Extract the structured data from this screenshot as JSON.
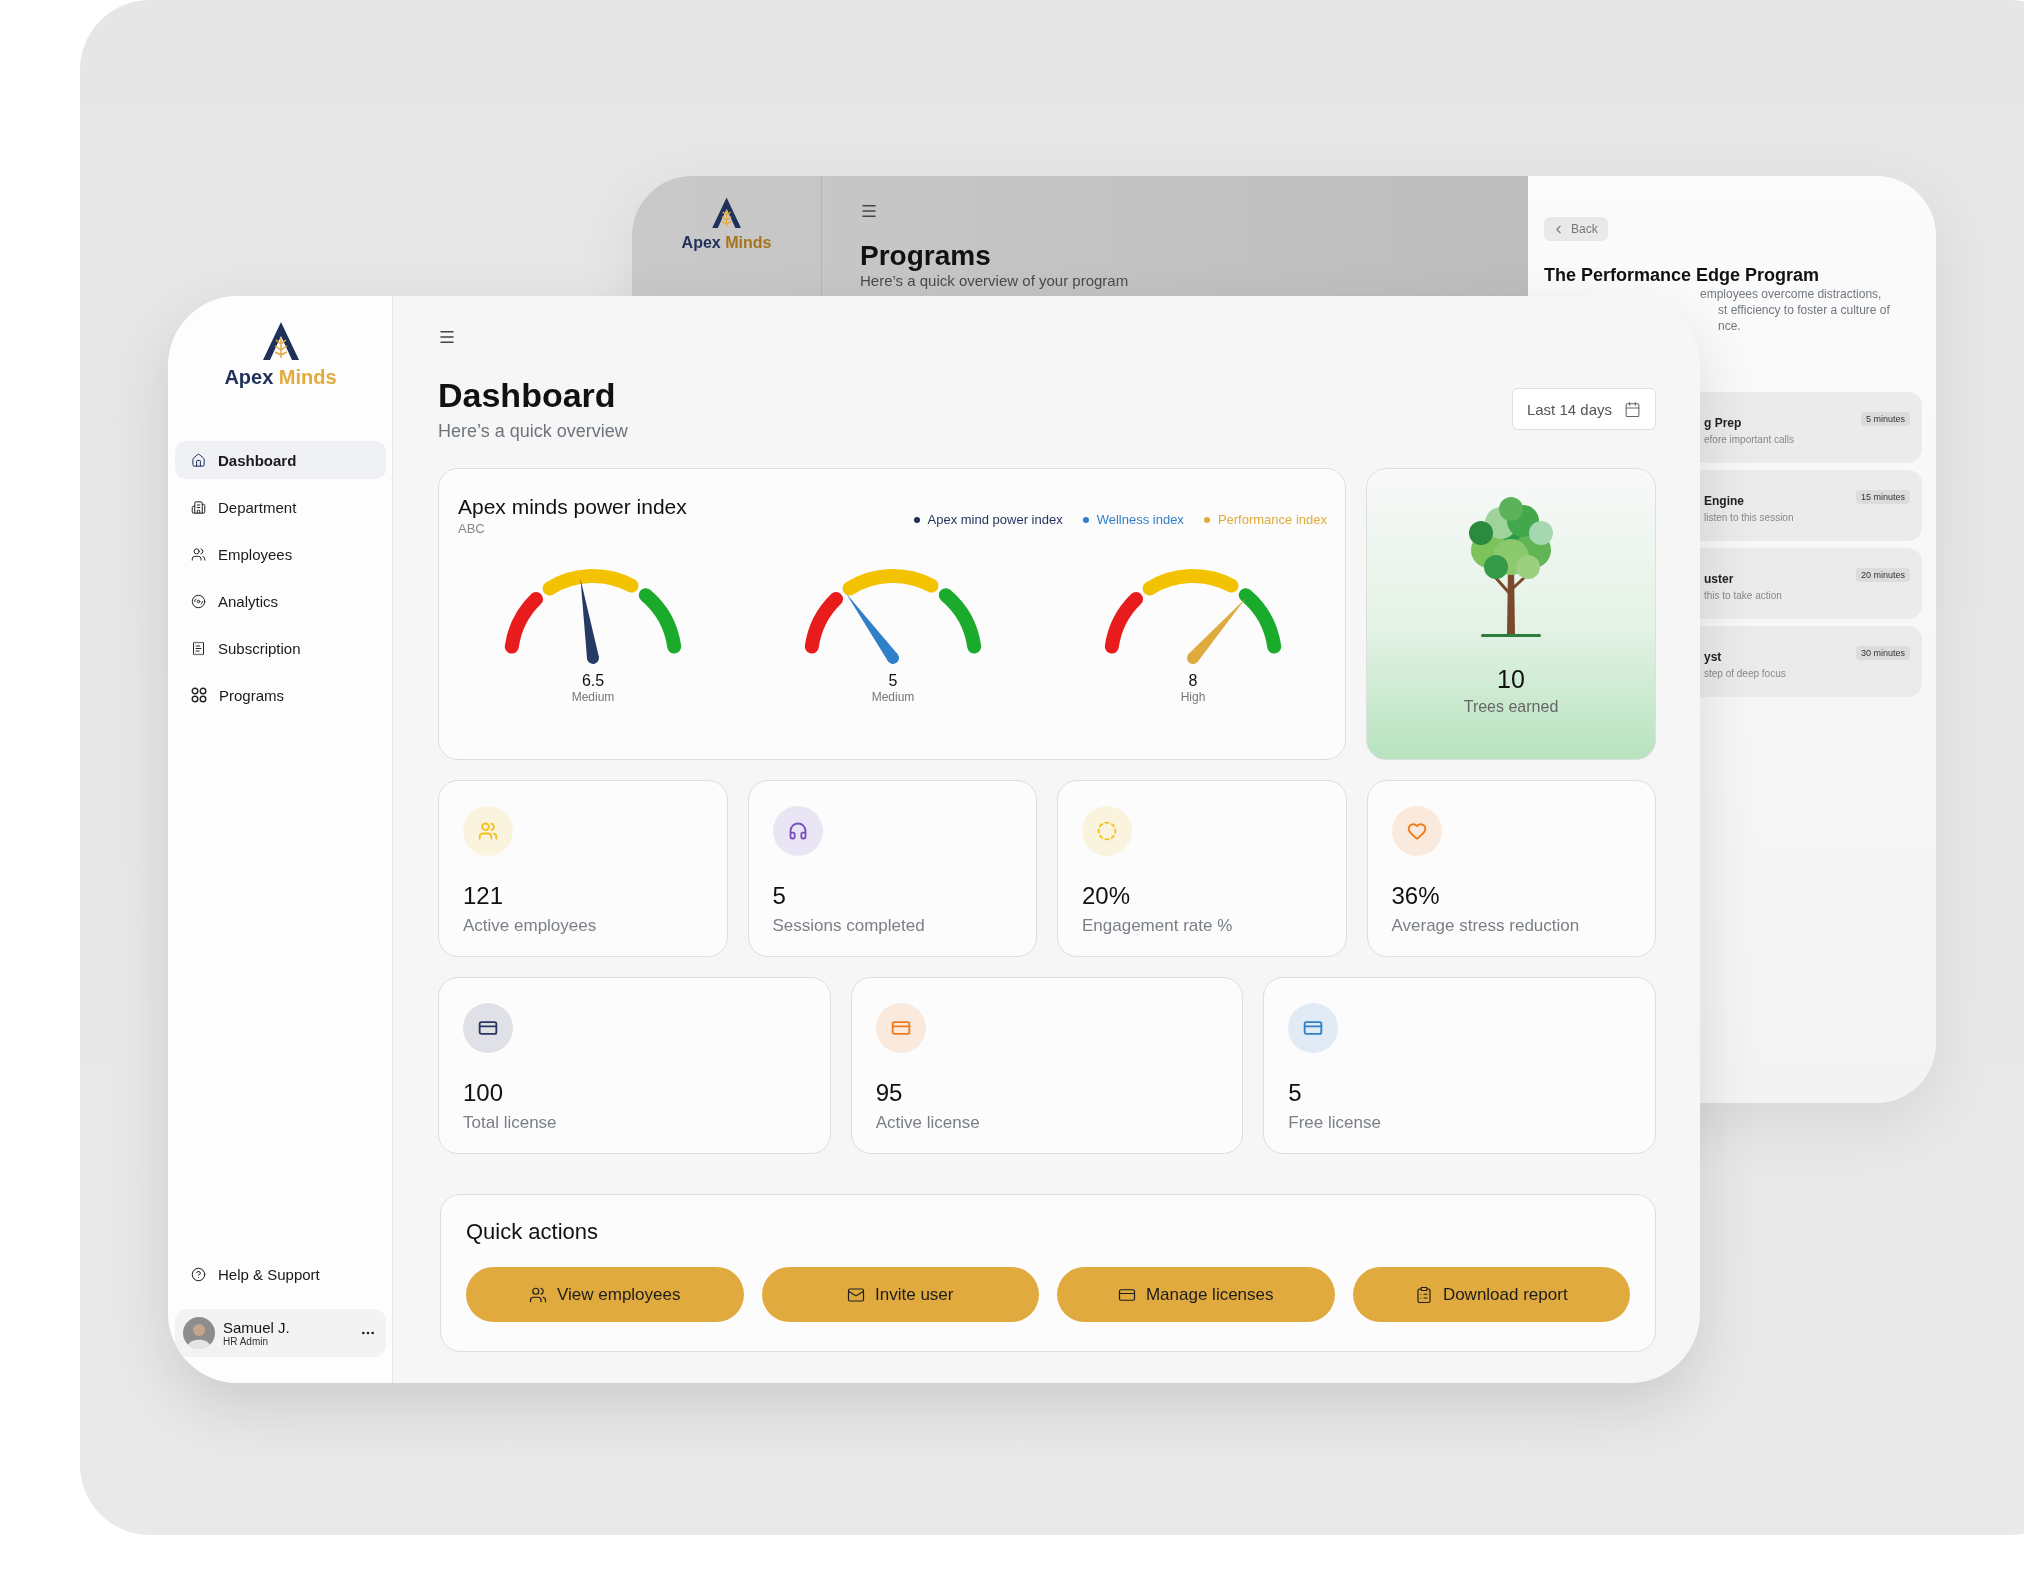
{
  "back_window": {
    "logo": {
      "first": "Apex",
      "second": "Minds"
    },
    "title": "Programs",
    "subtitle": "Here’s a quick overview of your program",
    "detail": {
      "back": "Back",
      "title": "The Performance Edge Program",
      "description_lines": [
        "employees overcome distractions,",
        "st efficiency to foster a culture of",
        "nce."
      ]
    },
    "sessions": [
      {
        "title": "g Prep",
        "subtitle": "efore important calls",
        "duration": "5 minutes"
      },
      {
        "title": "Engine",
        "subtitle": "listen to this session",
        "duration": "15 minutes"
      },
      {
        "title": "uster",
        "subtitle": "this to take action",
        "duration": "20 minutes"
      },
      {
        "title": "yst",
        "subtitle": "step of deep focus",
        "duration": "30 minutes"
      }
    ]
  },
  "sidebar": {
    "logo": {
      "first": "Apex",
      "second": "Minds"
    },
    "items": [
      {
        "label": "Dashboard",
        "selected": true
      },
      {
        "label": "Department",
        "selected": false
      },
      {
        "label": "Employees",
        "selected": false
      },
      {
        "label": "Analytics",
        "selected": false
      },
      {
        "label": "Subscription",
        "selected": false
      },
      {
        "label": "Programs",
        "selected": false
      }
    ],
    "help": "Help & Support",
    "user": {
      "name": "Samuel J.",
      "role": "HR Admin"
    }
  },
  "header": {
    "title": "Dashboard",
    "subtitle": "Here’s a quick overview",
    "date_range": "Last 14 days"
  },
  "power_index": {
    "title": "Apex minds power index",
    "subtitle": "ABC",
    "legend": [
      {
        "label": "Apex mind power index",
        "color": "#1f3159"
      },
      {
        "label": "Wellness index",
        "color": "#2f80c8"
      },
      {
        "label": "Performance index",
        "color": "#e0ab3a"
      }
    ],
    "gauges": [
      {
        "value": "6.5",
        "rating": "Medium",
        "level": 0.45,
        "color": "#263a63"
      },
      {
        "value": "5",
        "rating": "Medium",
        "level": 0.3,
        "color": "#2f80c8"
      },
      {
        "value": "8",
        "rating": "High",
        "level": 0.73,
        "color": "#dfab3f"
      }
    ]
  },
  "trees": {
    "count": "10",
    "label": "Trees earned"
  },
  "stats": [
    {
      "value": "121",
      "label": "Active employees",
      "color": "#f2c21b"
    },
    {
      "value": "5",
      "label": "Sessions completed",
      "color": "#7a4fc0"
    },
    {
      "value": "20%",
      "label": "Engagement rate %",
      "color": "#f2c21b"
    },
    {
      "value": "36%",
      "label": "Average stress reduction",
      "color": "#f07a1a"
    }
  ],
  "licenses": [
    {
      "value": "100",
      "label": "Total license",
      "color": "#2b3560"
    },
    {
      "value": "95",
      "label": "Active license",
      "color": "#f07a1a"
    },
    {
      "value": "5",
      "label": "Free license",
      "color": "#2f80c8"
    }
  ],
  "quick_actions": {
    "title": "Quick actions",
    "buttons": [
      {
        "label": "View employees"
      },
      {
        "label": "Invite user"
      },
      {
        "label": "Manage licenses"
      },
      {
        "label": "Download report"
      }
    ]
  }
}
